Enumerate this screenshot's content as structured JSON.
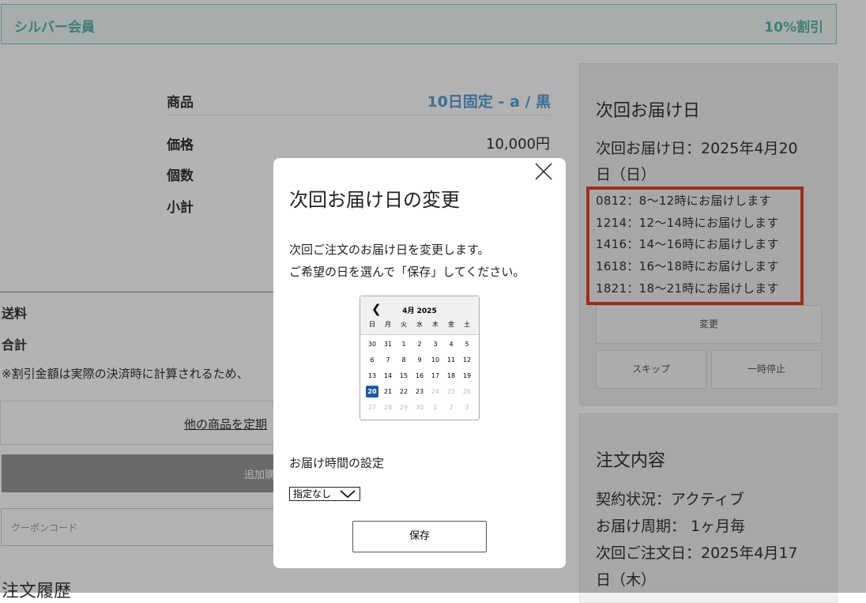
{
  "member": {
    "name": "シルバー会員",
    "discount": "10%割引"
  },
  "product": {
    "label_product": "商品",
    "product_name": "10日固定 - a / 黒",
    "label_price": "価格",
    "price": "10,000円",
    "label_qty": "個数",
    "label_subtotal": "小計"
  },
  "summary": {
    "label_shipping": "送料",
    "label_total": "合計",
    "note": "※割引金額は実際の決済時に計算されるため、",
    "periodic_link": "他の商品を定期",
    "add_button": "追加購",
    "coupon_placeholder": "クーポンコード",
    "history_title": "注文履歴"
  },
  "delivery_panel": {
    "title": "次回お届け日",
    "date_line1": "次回お届け日：2025年4月20",
    "date_line2": "日（日）",
    "slots": [
      "0812：8〜12時にお届けします",
      "1214：12〜14時にお届けします",
      "1416：14〜16時にお届けします",
      "1618：16〜18時にお届けします",
      "1821：18〜21時にお届けします"
    ],
    "change_button": "変更",
    "skip_button": "スキップ",
    "pause_button": "一時停止"
  },
  "order_panel": {
    "title": "注文内容",
    "status": "契約状況：アクティブ",
    "cycle": "お届け周期：  1ヶ月毎",
    "next_order_line1": "次回ご注文日：2025年4月17",
    "next_order_line2": "日（木）"
  },
  "modal": {
    "title": "次回お届け日の変更",
    "desc_line1": "次回ご注文のお届け日を変更します。",
    "desc_line2": "ご希望の日を選んで「保存」してください。",
    "calendar": {
      "month_label": "4月 2025",
      "prev_glyph": "❮",
      "weekdays": [
        "日",
        "月",
        "火",
        "水",
        "木",
        "金",
        "土"
      ],
      "weeks": [
        [
          "30",
          "31",
          "1",
          "2",
          "3",
          "4",
          "5"
        ],
        [
          "6",
          "7",
          "8",
          "9",
          "10",
          "11",
          "12"
        ],
        [
          "13",
          "14",
          "15",
          "16",
          "17",
          "18",
          "19"
        ],
        [
          "20",
          "21",
          "22",
          "23",
          "24",
          "25",
          "26"
        ],
        [
          "27",
          "28",
          "29",
          "30",
          "1",
          "2",
          "3"
        ]
      ],
      "selected": "20"
    },
    "time_title": "お届け時間の設定",
    "time_select_value": "指定なし",
    "save_button": "保存"
  }
}
